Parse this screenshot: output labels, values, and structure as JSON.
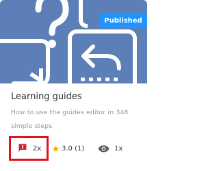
{
  "card": {
    "status_badge": "Published",
    "title": "Learning guides",
    "description": "How to use the guides editor in 348 simple steps",
    "stats": {
      "flags": "2x",
      "rating": "3.0 (1)",
      "views": "1x"
    }
  },
  "icons": {
    "flag": "report-flag-icon",
    "rating": "star-icon",
    "views": "eye-icon"
  },
  "colors": {
    "thumbnail_bg": "#5b7fb6",
    "badge_bg": "#1f95ff",
    "flag_red": "#d2222d",
    "star": "#f5b400",
    "highlight_border": "#e3111d"
  }
}
